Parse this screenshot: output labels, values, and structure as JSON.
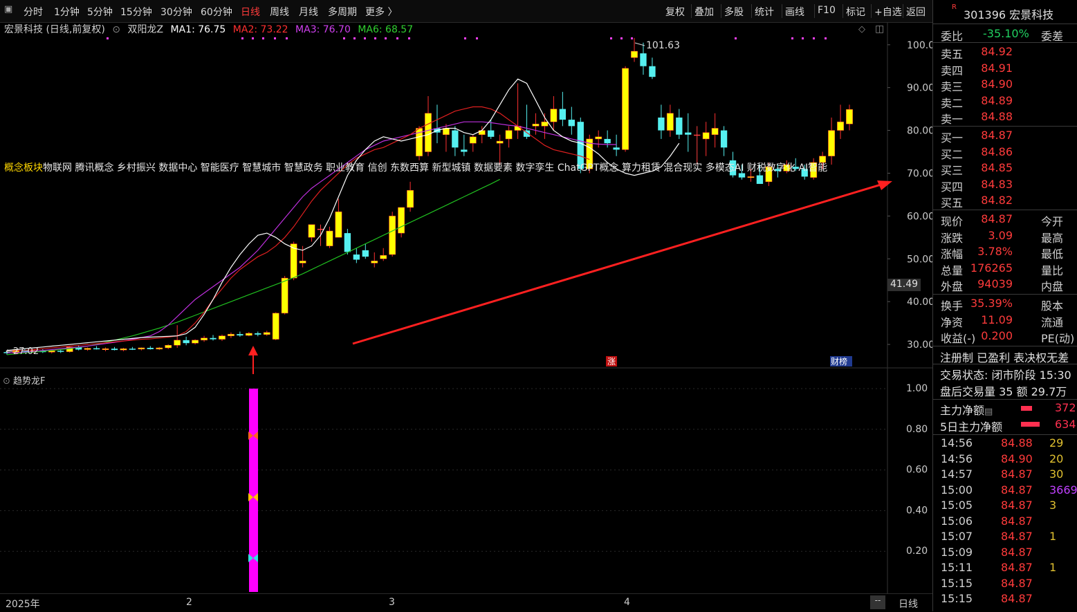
{
  "toolbar": {
    "left_items": [
      "分时",
      "1分钟",
      "5分钟",
      "15分钟",
      "30分钟",
      "60分钟",
      "日线",
      "周线",
      "月线",
      "多周期",
      "更多 〉"
    ],
    "active_index": 6,
    "right_items": [
      "复权",
      "叠加",
      "多股",
      "统计",
      "画线",
      "F10",
      "标记",
      "+自选",
      "返回"
    ]
  },
  "legend": {
    "stock": "宏景科技 (日线,前复权)",
    "indicator": "双阳龙Z",
    "ma1": "MA1: 76.75",
    "ma2": "MA2: 73.22",
    "ma3": "MA3: 76.70",
    "ma6": "MA6: 68.57"
  },
  "concepts": {
    "label": "概念板块",
    "items": "物联网 腾讯概念 乡村振兴 数据中心 智能医疗 智慧城市 智慧政务 职业教育 信创 东数西算 新型城镇 数据要素 数字孪生 ChatGPT概念 算力租赁 混合现实 多模态AI 财税数字化 AI智能"
  },
  "price_axis": [
    "100.0",
    "90.00",
    "80.00",
    "70.00",
    "60.00",
    "50.00",
    "40.00",
    "30.00"
  ],
  "price_axis_marker": "41.49",
  "high_label": "101.63",
  "low_label": "←27.02",
  "badges": {
    "zhang": "涨",
    "caibang": "财榜"
  },
  "sub_indicator": {
    "title": "趋势龙F",
    "axis": [
      "1.00",
      "0.80",
      "0.60",
      "0.40",
      "0.20"
    ]
  },
  "time_axis": {
    "labels": [
      "2025年",
      "2",
      "3",
      "4"
    ],
    "period": "日线",
    "scroll": "--"
  },
  "side": {
    "code": "301396",
    "name": "宏景科技",
    "badge": "R",
    "weibi_label": "委比",
    "weibi_value": "-35.10%",
    "weicha_label": "委差",
    "asks": [
      {
        "label": "卖五",
        "price": "84.92"
      },
      {
        "label": "卖四",
        "price": "84.91"
      },
      {
        "label": "卖三",
        "price": "84.90"
      },
      {
        "label": "卖二",
        "price": "84.89"
      },
      {
        "label": "卖一",
        "price": "84.88"
      }
    ],
    "bids": [
      {
        "label": "买一",
        "price": "84.87"
      },
      {
        "label": "买二",
        "price": "84.86"
      },
      {
        "label": "买三",
        "price": "84.85"
      },
      {
        "label": "买四",
        "price": "84.83"
      },
      {
        "label": "买五",
        "price": "84.82"
      }
    ],
    "stats1": [
      {
        "label": "现价",
        "value": "84.87",
        "extra": "今开"
      },
      {
        "label": "涨跌",
        "value": "3.09",
        "extra": "最高"
      },
      {
        "label": "涨幅",
        "value": "3.78%",
        "extra": "最低"
      },
      {
        "label": "总量",
        "value": "176265",
        "extra": "量比"
      },
      {
        "label": "外盘",
        "value": "94039",
        "extra": "内盘"
      }
    ],
    "stats2": [
      {
        "label": "换手",
        "value": "35.39%",
        "extra": "股本"
      },
      {
        "label": "净资",
        "value": "11.09",
        "extra": "流通"
      },
      {
        "label": "收益(-)",
        "value": "0.200",
        "extra": "PE(动)"
      }
    ],
    "reg": "注册制 已盈利 表决权无差",
    "trade_status": "交易状态: 闭市阶段 15:30",
    "after_hours": "盘后交易量 35 额 29.7万",
    "main_flow_label": "主力净额",
    "main_flow_value": "372",
    "main5_label": "5日主力净额",
    "main5_value": "634",
    "ticks": [
      {
        "t": "14:56",
        "p": "84.88",
        "v": "29"
      },
      {
        "t": "14:56",
        "p": "84.90",
        "v": "20"
      },
      {
        "t": "14:57",
        "p": "84.87",
        "v": "30"
      },
      {
        "t": "15:00",
        "p": "84.87",
        "v": "3669"
      },
      {
        "t": "15:05",
        "p": "84.87",
        "v": "3"
      },
      {
        "t": "15:06",
        "p": "84.87",
        "v": ""
      },
      {
        "t": "15:07",
        "p": "84.87",
        "v": "1"
      },
      {
        "t": "15:09",
        "p": "84.87",
        "v": ""
      },
      {
        "t": "15:11",
        "p": "84.87",
        "v": "1"
      },
      {
        "t": "15:15",
        "p": "84.87",
        "v": ""
      },
      {
        "t": "15:15",
        "p": "84.87",
        "v": ""
      }
    ]
  },
  "chart_data": {
    "type": "candlestick",
    "y_range": [
      25,
      104
    ],
    "colors": {
      "up": "#ffff00",
      "down": "#55f0f0",
      "flat": "#ff4040",
      "ma1": "#ffffff",
      "ma2": "#e02020",
      "ma3": "#c030e0",
      "ma6": "#20c020"
    },
    "candles": [
      [
        28.2,
        28.6,
        27.6,
        28.0
      ],
      [
        28.0,
        28.9,
        27.8,
        28.7
      ],
      [
        28.7,
        29.0,
        28.1,
        28.3
      ],
      [
        28.3,
        28.8,
        27.9,
        28.6
      ],
      [
        28.6,
        28.9,
        28.0,
        28.2
      ],
      [
        28.2,
        28.7,
        27.9,
        28.5
      ],
      [
        28.5,
        28.8,
        28.0,
        28.3
      ],
      [
        28.3,
        29.6,
        28.1,
        29.4
      ],
      [
        29.4,
        29.8,
        28.6,
        28.8
      ],
      [
        28.8,
        29.3,
        28.5,
        29.1
      ],
      [
        29.1,
        29.6,
        28.8,
        28.9
      ],
      [
        28.9,
        29.3,
        28.4,
        29.0
      ],
      [
        29.0,
        29.4,
        28.6,
        28.7
      ],
      [
        28.7,
        29.2,
        28.4,
        29.0
      ],
      [
        29.0,
        29.4,
        28.7,
        28.9
      ],
      [
        28.9,
        29.3,
        28.6,
        29.2
      ],
      [
        29.2,
        29.6,
        28.8,
        28.9
      ],
      [
        28.9,
        29.4,
        28.7,
        29.2
      ],
      [
        29.2,
        30.0,
        28.9,
        29.8
      ],
      [
        29.8,
        34.5,
        29.2,
        31.0
      ],
      [
        31.0,
        31.8,
        29.8,
        30.3
      ],
      [
        30.3,
        31.2,
        30.0,
        31.0
      ],
      [
        31.0,
        32.0,
        30.6,
        31.5
      ],
      [
        31.5,
        32.2,
        30.9,
        31.2
      ],
      [
        31.2,
        32.3,
        30.8,
        32.0
      ],
      [
        32.0,
        32.8,
        31.5,
        32.4
      ],
      [
        32.4,
        33.0,
        31.8,
        32.1
      ],
      [
        32.1,
        32.9,
        31.9,
        32.6
      ],
      [
        32.6,
        33.0,
        31.9,
        32.3
      ],
      [
        32.3,
        33.2,
        32.0,
        32.8
      ],
      [
        31.2,
        37.5,
        31.0,
        37.3
      ],
      [
        37.3,
        46.0,
        37.0,
        45.5
      ],
      [
        45.5,
        54.0,
        45.0,
        53.5
      ],
      [
        49.0,
        53.0,
        48.0,
        49.5
      ],
      [
        55.0,
        58.0,
        54.0,
        58.0
      ],
      [
        57.0,
        58.0,
        53.0,
        57.0
      ],
      [
        53.0,
        57.5,
        52.5,
        56.5
      ],
      [
        55.0,
        64.0,
        55.0,
        61.0
      ],
      [
        56.0,
        57.0,
        51.0,
        51.6
      ],
      [
        51.0,
        52.5,
        49.0,
        49.8
      ],
      [
        52.0,
        53.5,
        50.0,
        50.5
      ],
      [
        49.0,
        51.5,
        48.0,
        49.5
      ],
      [
        50.0,
        52.5,
        49.5,
        50.8
      ],
      [
        51.0,
        61.0,
        50.5,
        60.0
      ],
      [
        56.0,
        62.0,
        55.0,
        62.0
      ],
      [
        62.0,
        68.0,
        61.0,
        66.0
      ],
      [
        74.0,
        81.0,
        73.0,
        80.5
      ],
      [
        75.0,
        88.0,
        74.0,
        84.0
      ],
      [
        80.5,
        86.0,
        77.0,
        79.5
      ],
      [
        79.0,
        81.5,
        75.0,
        80.5
      ],
      [
        80.0,
        81.0,
        74.0,
        76.0
      ],
      [
        75.5,
        79.0,
        74.0,
        75.0
      ],
      [
        77.0,
        79.0,
        75.0,
        78.5
      ],
      [
        79.0,
        81.0,
        77.0,
        80.0
      ],
      [
        80.0,
        82.5,
        78.0,
        78.5
      ],
      [
        77.0,
        79.0,
        72.0,
        77.5
      ],
      [
        78.0,
        81.0,
        76.0,
        80.0
      ],
      [
        80.0,
        91.0,
        78.0,
        81.0
      ],
      [
        80.0,
        86.0,
        78.0,
        78.5
      ],
      [
        81.0,
        84.0,
        79.0,
        81.5
      ],
      [
        81.0,
        84.0,
        78.0,
        82.0
      ],
      [
        82.0,
        88.0,
        80.0,
        85.0
      ],
      [
        85.0,
        89.0,
        81.0,
        82.5
      ],
      [
        82.5,
        85.5,
        79.0,
        81.0
      ],
      [
        82.0,
        83.0,
        70.0,
        71.0
      ],
      [
        71.0,
        79.0,
        70.0,
        78.0
      ],
      [
        78.0,
        80.0,
        76.0,
        78.5
      ],
      [
        78.0,
        80.0,
        76.0,
        77.0
      ],
      [
        76.0,
        79.0,
        74.0,
        75.5
      ],
      [
        75.5,
        95.0,
        75.0,
        94.5
      ],
      [
        97.0,
        101.6,
        96.0,
        98.5
      ],
      [
        98.0,
        100.5,
        93.0,
        95.0
      ],
      [
        95.0,
        97.0,
        92.0,
        92.5
      ],
      [
        83.0,
        86.0,
        78.0,
        80.0
      ],
      [
        80.0,
        86.0,
        78.5,
        84.0
      ],
      [
        83.0,
        85.0,
        78.0,
        79.0
      ],
      [
        79.5,
        84.0,
        75.0,
        79.0
      ],
      [
        79.0,
        81.0,
        72.0,
        79.0
      ],
      [
        78.0,
        82.0,
        74.0,
        79.5
      ],
      [
        79.0,
        84.0,
        76.0,
        80.5
      ],
      [
        80.0,
        81.0,
        74.0,
        76.0
      ],
      [
        73.0,
        75.0,
        69.0,
        69.5
      ],
      [
        70.0,
        72.0,
        68.5,
        69.0
      ],
      [
        69.0,
        71.0,
        68.0,
        69.2
      ],
      [
        69.5,
        72.0,
        68.0,
        67.5
      ],
      [
        68.0,
        72.5,
        67.0,
        71.5
      ],
      [
        71.0,
        72.0,
        69.0,
        70.5
      ],
      [
        70.5,
        73.0,
        70.0,
        72.0
      ],
      [
        71.5,
        73.5,
        70.5,
        71.0
      ],
      [
        71.0,
        72.0,
        68.5,
        69.2
      ],
      [
        69.0,
        73.5,
        68.5,
        72.5
      ],
      [
        72.5,
        75.0,
        71.0,
        74.0
      ],
      [
        74.0,
        83.0,
        72.0,
        80.0
      ],
      [
        80.0,
        86.0,
        78.0,
        82.0
      ],
      [
        81.5,
        86.0,
        80.0,
        84.9
      ]
    ],
    "ma1": [
      28.6,
      28.8,
      29.0,
      29.2,
      29.4,
      29.6,
      29.8,
      30.0,
      30.2,
      30.4,
      30.6,
      30.8,
      31.0,
      31.2,
      31.4,
      31.6,
      31.7,
      31.8,
      31.9,
      32.0,
      32.5,
      34.0,
      37.0,
      40.5,
      44.5,
      48.0,
      51.0,
      53.5,
      55.5,
      56.0,
      55.0,
      53.5,
      52.5,
      52.0,
      53.0,
      55.5,
      59.5,
      64.5,
      69.5,
      73.0,
      75.5,
      77.5,
      78.5,
      78.0,
      77.5,
      78.0,
      78.5,
      79.0,
      80.0,
      80.5,
      80.5,
      79.5,
      79.0,
      80.0,
      82.5,
      86.0,
      89.5,
      92.0,
      91.0,
      87.0,
      83.0,
      80.0,
      78.5,
      77.5,
      77.0,
      76.0,
      74.5,
      72.5,
      71.0,
      70.0,
      69.5,
      70.0,
      70.5,
      71.5,
      74.0,
      77.0
    ],
    "ma1_start": 19,
    "ma2": [
      28.4,
      28.5,
      28.6,
      28.8,
      29.0,
      29.2,
      29.4,
      29.6,
      29.8,
      30.0,
      30.2,
      30.4,
      30.6,
      30.8,
      31.0,
      31.2,
      31.3,
      31.5,
      31.7,
      32.0,
      33.0,
      35.0,
      37.5,
      40.5,
      43.0,
      45.5,
      47.5,
      49.0,
      50.5,
      51.5,
      53.0,
      55.0,
      57.5,
      60.5,
      63.5,
      66.0,
      68.0,
      70.0,
      72.0,
      73.5,
      74.5,
      75.5,
      76.0,
      77.0,
      78.0,
      79.0,
      80.5,
      81.5,
      82.5,
      83.5,
      84.5,
      85.0,
      85.5,
      85.5,
      85.0,
      84.0,
      82.5,
      81.0,
      79.5,
      78.0,
      76.5,
      75.5,
      75.0,
      74.5,
      74.0,
      73.2
    ],
    "ma2_start": 29,
    "ma3": [
      28.0,
      28.1,
      28.2,
      28.4,
      28.6,
      28.8,
      29.0,
      29.2,
      29.4,
      29.6,
      29.9,
      30.2,
      30.5,
      30.8,
      31.2,
      31.6,
      32.0,
      33.0,
      34.5,
      36.5,
      38.5,
      40.5,
      42.0,
      43.5,
      45.0,
      46.5,
      48.0,
      50.0,
      52.0,
      54.5,
      57.0,
      59.5,
      62.0,
      64.5,
      66.5,
      68.0,
      69.5,
      71.0,
      72.5,
      74.0,
      75.5,
      76.5,
      77.5,
      78.0,
      78.5,
      79.0,
      79.5,
      80.0,
      80.5,
      81.0,
      81.5,
      82.0,
      82.0,
      82.0,
      81.8,
      81.5,
      81.2,
      81.0,
      80.5,
      80.0,
      79.5,
      79.0,
      78.5,
      78.0,
      77.5,
      77.0,
      76.8,
      76.7,
      76.7
    ],
    "ma3_start": 26,
    "ma6": [
      27.6,
      27.8,
      28.0,
      28.2,
      28.4,
      28.6,
      28.8,
      29.0,
      29.3,
      29.6,
      30.0,
      30.5,
      31.0,
      31.5,
      32.0,
      32.6,
      33.2,
      33.8,
      34.5,
      35.2,
      36.0,
      36.8,
      37.6,
      38.4,
      39.2,
      40.0,
      40.8,
      41.6,
      42.4,
      43.2,
      44.0,
      44.8,
      45.6,
      46.5,
      47.5,
      48.5,
      49.5,
      50.5,
      51.5,
      52.5,
      53.5,
      54.5,
      55.5,
      56.5,
      57.5,
      58.5,
      59.5,
      60.5,
      61.5,
      62.5,
      63.5,
      64.5,
      65.5,
      66.5,
      67.5,
      68.57
    ],
    "ma6_start": 38,
    "sub_bar": {
      "value": 1.0
    }
  }
}
